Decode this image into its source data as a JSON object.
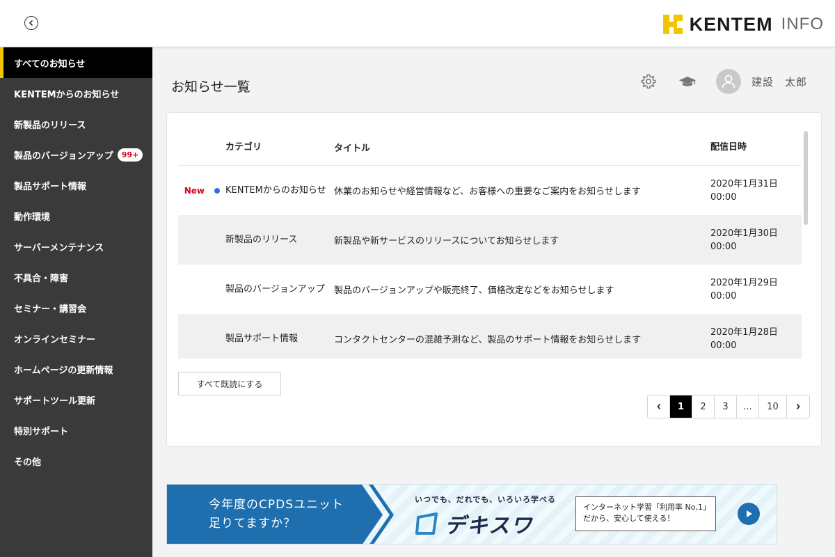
{
  "header": {
    "logo_text": "KENTEM",
    "logo_sub": "INFO",
    "brand_color": "#f5c400"
  },
  "sidebar": {
    "items": [
      {
        "label": "すべてのお知らせ"
      },
      {
        "label": "KENTEMからのお知らせ"
      },
      {
        "label": "新製品のリリース"
      },
      {
        "label": "製品のバージョンアップ",
        "badge": "99+"
      },
      {
        "label": "製品サポート情報"
      },
      {
        "label": "動作環境"
      },
      {
        "label": "サーバーメンテナンス"
      },
      {
        "label": "不具合・障害"
      },
      {
        "label": "セミナー・講習会"
      },
      {
        "label": "オンラインセミナー"
      },
      {
        "label": "ホームページの更新情報"
      },
      {
        "label": "サポートツール更新"
      },
      {
        "label": "特別サポート"
      },
      {
        "label": "その他"
      }
    ]
  },
  "main": {
    "title": "お知らせ一覧",
    "user_name": "建設　太郎",
    "table": {
      "headers": {
        "category": "カテゴリ",
        "title": "タイトル",
        "date": "配信日時"
      },
      "rows": [
        {
          "new": "New",
          "category": "KENTEMからのお知らせ",
          "title": "休業のお知らせや経営情報など、お客様への重要なご案内をお知らせします",
          "date": "2020年1月31日",
          "time": "00:00"
        },
        {
          "new": "",
          "category": "新製品のリリース",
          "title": "新製品や新サービスのリリースについてお知らせします",
          "date": "2020年1月30日",
          "time": "00:00"
        },
        {
          "new": "",
          "category": "製品のバージョンアップ",
          "title": "製品のバージョンアップや販売終了、価格改定などをお知らせします",
          "date": "2020年1月29日",
          "time": "00:00"
        },
        {
          "new": "",
          "category": "製品サポート情報",
          "title": "コンタクトセンターの混雑予測など、製品のサポート情報をお知らせします",
          "date": "2020年1月28日",
          "time": "00:00"
        }
      ]
    },
    "read_all_label": "すべて既読にする",
    "pagination": {
      "pages": [
        "1",
        "2",
        "3",
        "...",
        "10"
      ],
      "current": "1"
    }
  },
  "banner": {
    "line1": "今年度のCPDSユニット",
    "line2": "足りてますか？",
    "tagline": "いつでも、だれでも、いろいろ学べる",
    "brand": "デキスワ",
    "note_line1": "インターネット学習「利用率 No,1」",
    "note_line2": "だから、安心して使える！"
  },
  "icons": {
    "back": "back-circle-icon",
    "settings": "gear-icon",
    "learning": "graduation-cap-icon",
    "avatar": "user-avatar-icon",
    "prev": "chevron-left-icon",
    "next": "chevron-right-icon",
    "play": "play-icon"
  }
}
